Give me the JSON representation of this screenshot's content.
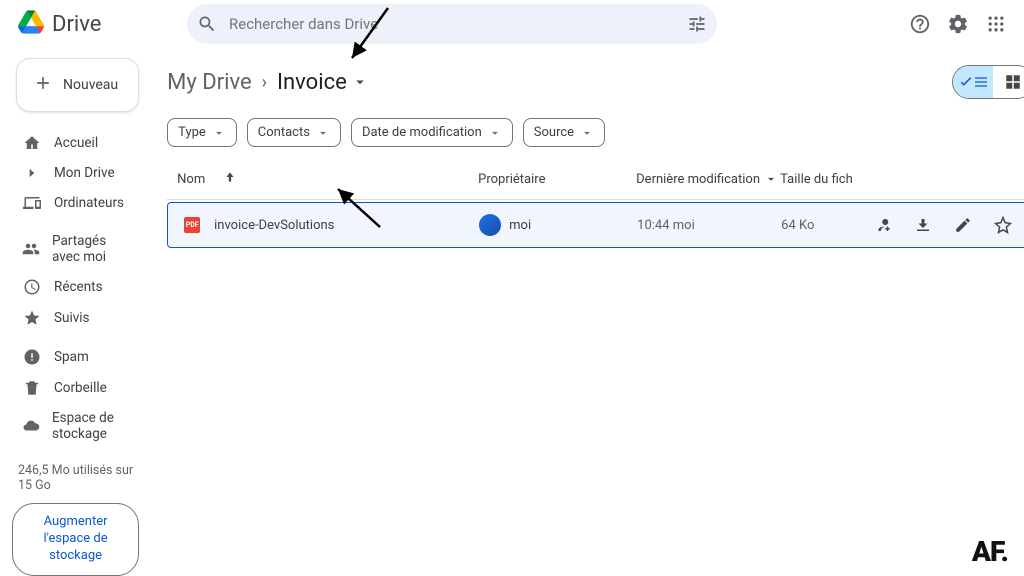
{
  "header": {
    "product_name": "Drive",
    "search_placeholder": "Rechercher dans Drive"
  },
  "sidebar": {
    "new_label": "Nouveau",
    "items": [
      {
        "label": "Accueil",
        "icon": "home-icon"
      },
      {
        "label": "Mon Drive",
        "icon": "drive-icon"
      },
      {
        "label": "Ordinateurs",
        "icon": "devices-icon"
      },
      {
        "label": "Partagés avec moi",
        "icon": "shared-icon"
      },
      {
        "label": "Récents",
        "icon": "recent-icon"
      },
      {
        "label": "Suivis",
        "icon": "star-icon"
      },
      {
        "label": "Spam",
        "icon": "spam-icon"
      },
      {
        "label": "Corbeille",
        "icon": "trash-icon"
      },
      {
        "label": "Espace de stockage",
        "icon": "cloud-icon"
      }
    ],
    "storage_text": "246,5 Mo utilisés sur 15 Go",
    "storage_btn": "Augmenter l'espace de stockage"
  },
  "breadcrumb": {
    "root": "My Drive",
    "current": "Invoice"
  },
  "filters": {
    "type": "Type",
    "contacts": "Contacts",
    "modified": "Date de modification",
    "source": "Source"
  },
  "columns": {
    "name": "Nom",
    "owner": "Propriétaire",
    "modified": "Dernière modification",
    "size": "Taille du fich"
  },
  "file": {
    "name": "invoice-DevSolutions",
    "owner": "moi",
    "modified_time": "10:44",
    "modified_by": "moi",
    "size": "64 Ko",
    "pdf_badge": "PDF"
  },
  "watermark": "AF."
}
